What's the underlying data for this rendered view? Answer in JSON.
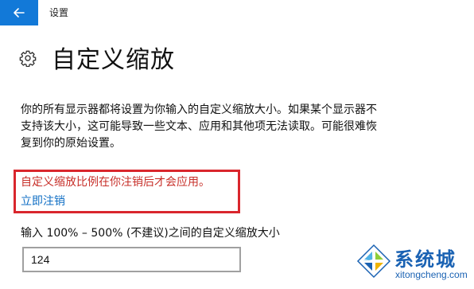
{
  "window": {
    "title": "设置",
    "back_icon": "back-arrow-icon",
    "back_bg_color": "#1279d8"
  },
  "page": {
    "icon": "gear-icon",
    "title": "自定义缩放",
    "description": "你的所有显示器都将设置为你输入的自定义缩放大小。如果某个显示器不支持该大小，这可能导致一些文本、应用和其他项无法读取。可能很难恢复到你的原始设置。",
    "alert": "自定义缩放比例在你注销后才会应用。",
    "alert_color": "#c72f29",
    "highlight_color": "#d9262d",
    "logout_link": "立即注销",
    "link_color": "#0f6ec4",
    "range_label": "输入 100% – 500% (不建议)之间的自定义缩放大小",
    "scale_value": "124"
  },
  "watermark": {
    "logo_icon": "windows-logo-icon",
    "text_cn": "系统城",
    "text_en": "xitongcheng.com",
    "color": "#1a62b3"
  }
}
